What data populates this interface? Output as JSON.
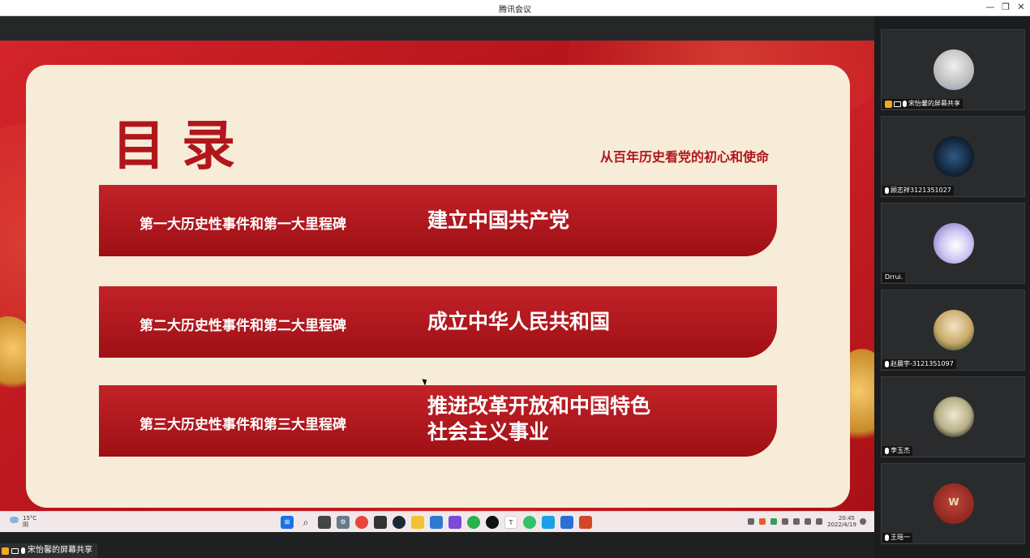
{
  "window": {
    "title": "腾讯会议",
    "minimize": "—",
    "restore": "❐",
    "close": "✕"
  },
  "slide": {
    "heading": "目录",
    "subheading": "从百年历史看党的初心和使命",
    "rows": [
      {
        "left": "第一大历史性事件和第一大里程碑",
        "right": "建立中国共产党"
      },
      {
        "left": "第二大历史性事件和第二大里程碑",
        "right": "成立中华人民共和国"
      },
      {
        "left": "第三大历史性事件和第三大里程碑",
        "right_line1": "推进改革开放和中国特色",
        "right_line2": "社会主义事业"
      }
    ]
  },
  "taskbar": {
    "temperature": "15°C",
    "weather": "阴",
    "time": "20:45",
    "date": "2022/4/19",
    "apps": [
      "start",
      "search",
      "task-view",
      "settings",
      "chrome",
      "camera",
      "steam",
      "file-explorer",
      "vscode",
      "feishu",
      "wechat",
      "qq",
      "typora",
      "qq-music",
      "maps",
      "mail",
      "powerpoint"
    ]
  },
  "sharer": {
    "label": "宋怡馨的屏幕共享"
  },
  "participants": [
    {
      "name": "宋怡馨的屏幕共享",
      "avatar_color": "#d9d9d9",
      "host": true,
      "sharing": true
    },
    {
      "name": "顾志祥3121351027",
      "avatar_color": "#1e3a5a",
      "host": false,
      "sharing": false
    },
    {
      "name": "Drrui.",
      "avatar_color": "#b8b0e8",
      "host": false,
      "sharing": false,
      "no_mic": true
    },
    {
      "name": "赵晨宇-3121351097",
      "avatar_color": "#d8c9a0",
      "host": false,
      "sharing": false
    },
    {
      "name": "李玉杰",
      "avatar_color": "#c9c4a8",
      "host": false,
      "sharing": false
    },
    {
      "name": "王瑶一",
      "avatar_color": "#a8322a",
      "host": false,
      "sharing": false,
      "avatar_letter": "W"
    }
  ]
}
